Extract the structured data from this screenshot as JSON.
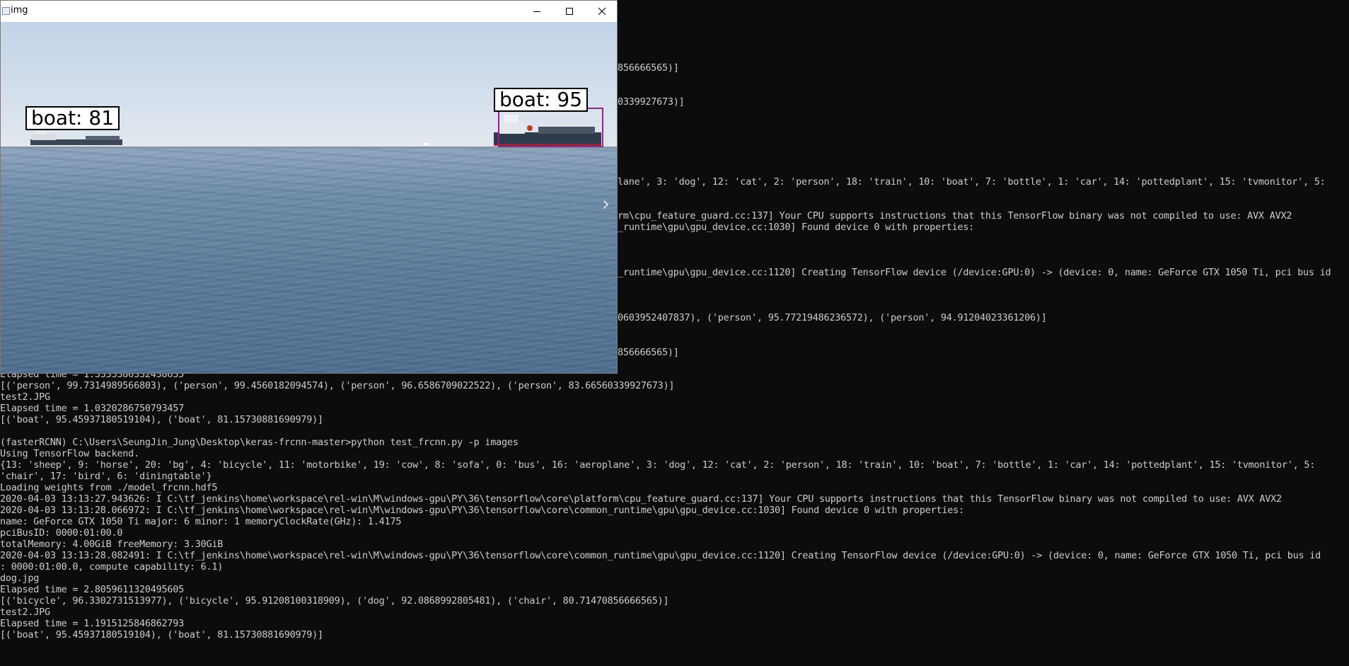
{
  "console": {
    "behind_lines": [
      "856666565)]",
      "0339927673)]",
      "lane', 3: 'dog', 12: 'cat', 2: 'person', 18: 'train', 10: 'boat', 7: 'bottle', 1: 'car', 14: 'pottedplant', 15: 'tvmonitor', 5:",
      "rm\\cpu_feature_guard.cc:137] Your CPU supports instructions that this TensorFlow binary was not compiled to use: AVX AVX2",
      "_runtime\\gpu\\gpu_device.cc:1030] Found device 0 with properties:",
      "_runtime\\gpu\\gpu_device.cc:1120] Creating TensorFlow device (/device:GPU:0) -> (device: 0, name: GeForce GTX 1050 Ti, pci bus id",
      "0603952407837), ('person', 95.77219486236572), ('person', 94.91204023361206)]",
      "856666565)]"
    ],
    "full_lines": [
      "Elapsed time = 1.3333386332438635",
      "[('person', 99.7314989566803), ('person', 99.4560182094574), ('person', 96.6586709022522), ('person', 83.66560339927673)]",
      "test2.JPG",
      "Elapsed time = 1.0320286750793457",
      "[('boat', 95.45937180519104), ('boat', 81.15730881690979)]",
      "",
      "(fasterRCNN) C:\\Users\\SeungJin_Jung\\Desktop\\keras-frcnn-master>python test_frcnn.py -p images",
      "Using TensorFlow backend.",
      "{13: 'sheep', 9: 'horse', 20: 'bg', 4: 'bicycle', 11: 'motorbike', 19: 'cow', 8: 'sofa', 0: 'bus', 16: 'aeroplane', 3: 'dog', 12: 'cat', 2: 'person', 18: 'train', 10: 'boat', 7: 'bottle', 1: 'car', 14: 'pottedplant', 15: 'tvmonitor', 5:",
      "'chair', 17: 'bird', 6: 'diningtable'}",
      "Loading weights from ./model_frcnn.hdf5",
      "2020-04-03 13:13:27.943626: I C:\\tf_jenkins\\home\\workspace\\rel-win\\M\\windows-gpu\\PY\\36\\tensorflow\\core\\platform\\cpu_feature_guard.cc:137] Your CPU supports instructions that this TensorFlow binary was not compiled to use: AVX AVX2",
      "2020-04-03 13:13:28.066972: I C:\\tf_jenkins\\home\\workspace\\rel-win\\M\\windows-gpu\\PY\\36\\tensorflow\\core\\common_runtime\\gpu\\gpu_device.cc:1030] Found device 0 with properties:",
      "name: GeForce GTX 1050 Ti major: 6 minor: 1 memoryClockRate(GHz): 1.4175",
      "pciBusID: 0000:01:00.0",
      "totalMemory: 4.00GiB freeMemory: 3.30GiB",
      "2020-04-03 13:13:28.082491: I C:\\tf_jenkins\\home\\workspace\\rel-win\\M\\windows-gpu\\PY\\36\\tensorflow\\core\\common_runtime\\gpu\\gpu_device.cc:1120] Creating TensorFlow device (/device:GPU:0) -> (device: 0, name: GeForce GTX 1050 Ti, pci bus id",
      ": 0000:01:00.0, compute capability: 6.1)",
      "dog.jpg",
      "Elapsed time = 2.8059611320495605",
      "[('bicycle', 96.3302731513977), ('bicycle', 95.91208100318909), ('dog', 92.0868992805481), ('chair', 80.71470856666565)]",
      "test2.JPG",
      "Elapsed time = 1.1915125846862793",
      "[('boat', 95.45937180519104), ('boat', 81.15730881690979)]"
    ]
  },
  "window": {
    "title": "img",
    "icons": [
      "minimize-icon",
      "maximize-icon",
      "close-icon"
    ]
  },
  "detections": [
    {
      "label": "boat: 81",
      "class": "boat",
      "score": 81
    },
    {
      "label": "boat: 95",
      "class": "boat",
      "score": 95
    }
  ],
  "colors": {
    "console_bg": "#0c0c0c",
    "console_text": "#cccccc",
    "box": "#8a2a86"
  }
}
